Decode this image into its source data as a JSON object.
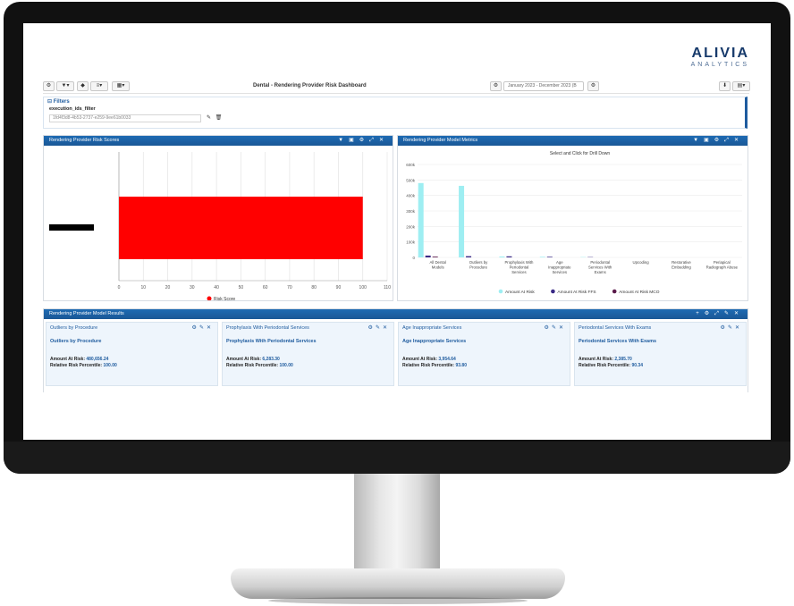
{
  "brand": {
    "name": "ALIVIA",
    "sub": "ANALYTICS"
  },
  "toolbar": {
    "title": "Dental - Rendering Provider Risk Dashboard",
    "date_range": "January 2023 - December 2023 (B"
  },
  "filters": {
    "header": "Filters",
    "key": "execution_ids_filter",
    "value": "1fd4f3d8-4b53-2737-e259-9ee61b0033"
  },
  "risk_panel": {
    "title": "Rendering Provider Risk Scores"
  },
  "metrics_panel": {
    "title": "Rendering Provider Model Metrics"
  },
  "results_panel": {
    "title": "Rendering Provider Model Results"
  },
  "chart_data": [
    {
      "type": "bar",
      "orientation": "horizontal",
      "categories": [
        "▬▬▬▬"
      ],
      "series": [
        {
          "name": "Risk Score",
          "values": [
            100
          ],
          "color": "#ff0000"
        }
      ],
      "xlim": [
        0,
        110
      ],
      "xticks": [
        "0",
        "10",
        "20",
        "30",
        "40",
        "50",
        "60",
        "70",
        "80",
        "90",
        "100",
        "110"
      ],
      "grid": true,
      "legend": "bottom"
    },
    {
      "type": "bar",
      "title": "Select and Click for Drill Down",
      "categories": [
        "All Dental Models",
        "Outliers by Procedure",
        "Prophylaxis With Periodontal Services",
        "Age Inappropriate Services",
        "Periodontal Services With Exams",
        "Upcoding",
        "Restorative Embedding",
        "Periapical Radiograph Abuse"
      ],
      "series": [
        {
          "name": "Amount At Risk",
          "color": "#9eeef2",
          "values": [
            480000,
            462000,
            6000,
            3900,
            2000,
            0,
            0,
            0
          ]
        },
        {
          "name": "Amount At Risk FFS",
          "color": "#3a2a86",
          "values": [
            12000,
            8000,
            7000,
            4000,
            2000,
            0,
            0,
            0
          ]
        },
        {
          "name": "Amount At Risk MCO",
          "color": "#5a1a4a",
          "values": [
            5000,
            0,
            0,
            0,
            0,
            0,
            0,
            0
          ]
        }
      ],
      "ylim": [
        0,
        600000
      ],
      "yticks": [
        "0",
        "100k",
        "200k",
        "300k",
        "400k",
        "500k",
        "600k"
      ],
      "grid": true,
      "legend": "bottom"
    }
  ],
  "results": [
    {
      "header": "Outliers by Procedure",
      "title": "Outliers by Procedure",
      "amount_label": "Amount At Risk:",
      "amount": "480,656.24",
      "pct_label": "Relative Risk Percentile:",
      "pct": "100.00"
    },
    {
      "header": "Prophylaxis With Periodontal Services",
      "title": "Prophylaxis With Periodontal Services",
      "amount_label": "Amount At Risk:",
      "amount": "6,283.30",
      "pct_label": "Relative Risk Percentile:",
      "pct": "100.00"
    },
    {
      "header": "Age Inappropriate Services",
      "title": "Age Inappropriate Services",
      "amount_label": "Amount At Risk:",
      "amount": "3,954.64",
      "pct_label": "Relative Risk Percentile:",
      "pct": "93.80"
    },
    {
      "header": "Periodontal Services With Exams",
      "title": "Periodontal Services With Exams",
      "amount_label": "Amount At Risk:",
      "amount": "2,385.70",
      "pct_label": "Relative Risk Percentile:",
      "pct": "90.34"
    }
  ]
}
